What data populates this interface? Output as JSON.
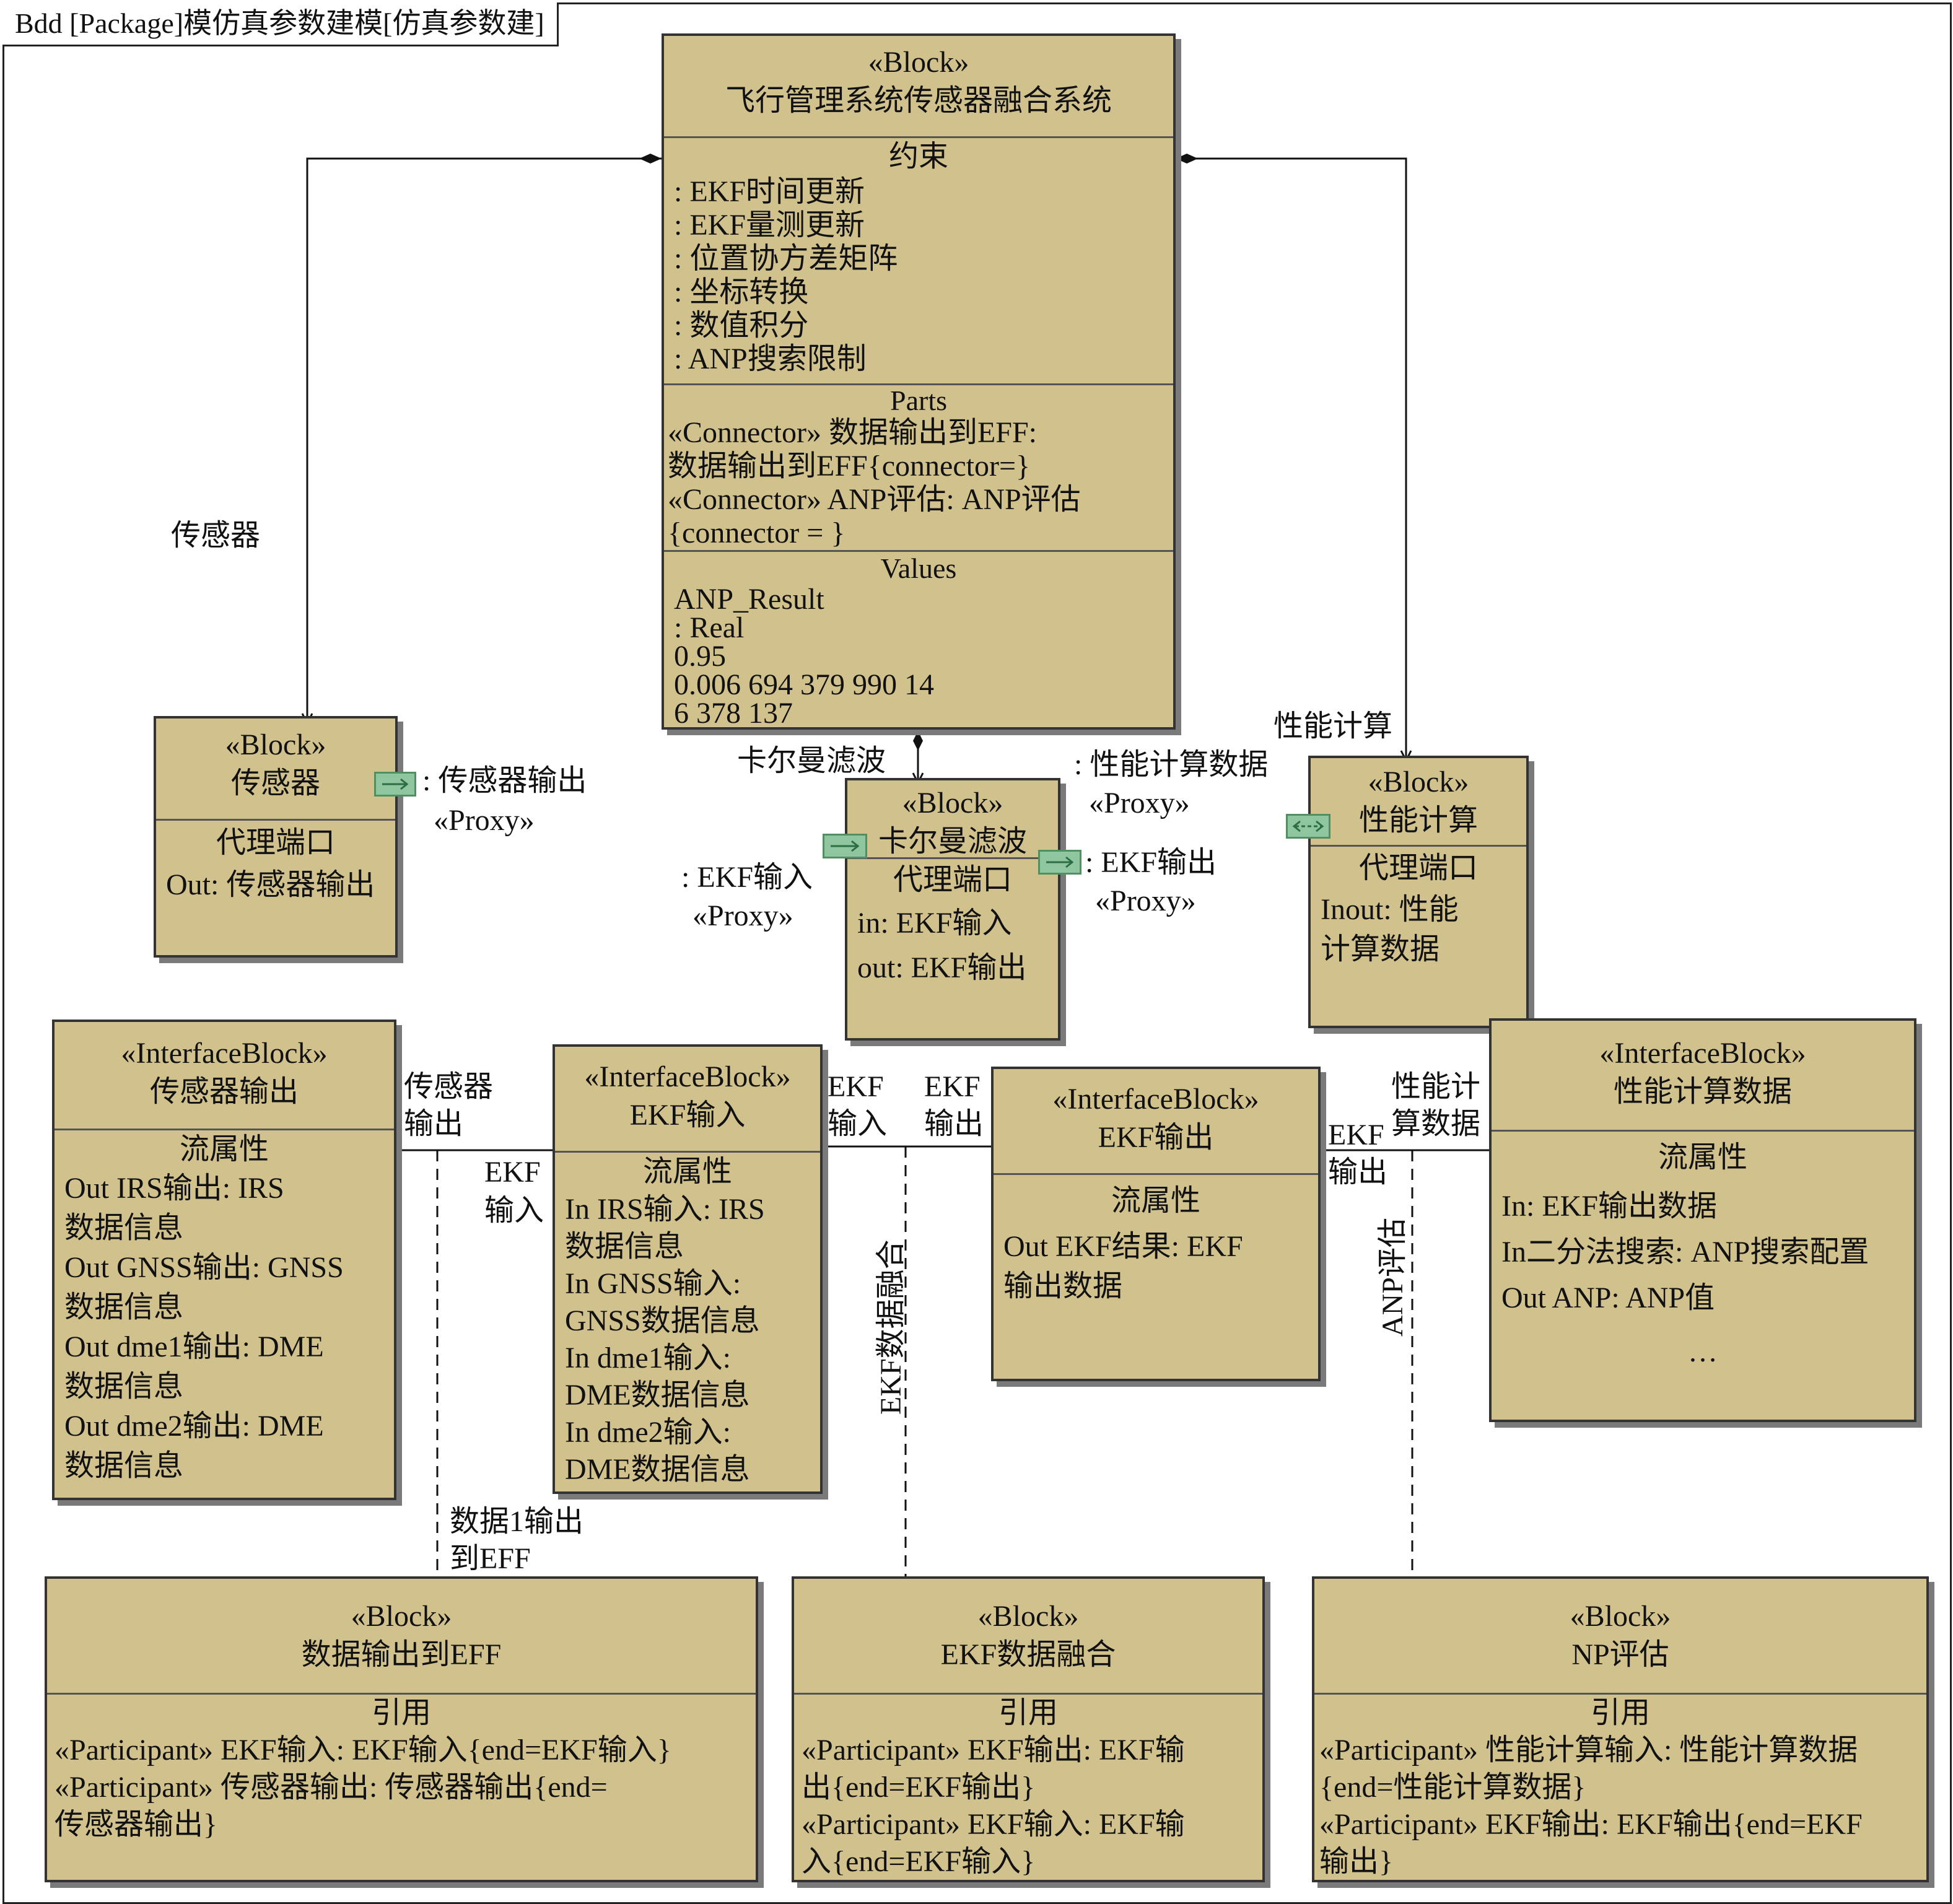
{
  "frame": {
    "title": "Bdd [Package]模仿真参数建模[仿真参数建]"
  },
  "colors": {
    "block_fill": "#d1c28d",
    "port_fill": "#8fc6a0",
    "line": "#111111"
  },
  "main_block": {
    "stereotype": "«Block»",
    "name": "飞行管理系统传感器融合系统",
    "constraints_title": "约束",
    "constraints": [
      ": EKF时间更新",
      ": EKF量测更新",
      ": 位置协方差矩阵",
      ": 坐标转换",
      ": 数值积分",
      ": ANP搜索限制"
    ],
    "parts_title": "Parts",
    "parts": [
      "«Connector» 数据输出到EFF:",
      "数据输出到EFF{connector=}",
      "«Connector» ANP评估: ANP评估",
      "{connector = }"
    ],
    "values_title": "Values",
    "values": [
      "ANP_Result",
      ": Real",
      "0.95",
      "0.006 694 379 990 14",
      "6 378 137"
    ]
  },
  "sensor_block": {
    "stereotype": "«Block»",
    "name": "传感器",
    "section_title": "代理端口",
    "rows": [
      "Out: 传感器输出"
    ],
    "port_label": ": 传感器输出",
    "port_stereo": "«Proxy»",
    "assoc_label": "传感器"
  },
  "kalman_block": {
    "stereotype": "«Block»",
    "name": "卡尔曼滤波",
    "section_title": "代理端口",
    "rows": [
      "in: EKF输入",
      "out: EKF输出"
    ],
    "in_port_label": ": EKF输入",
    "in_port_stereo": "«Proxy»",
    "out_port_label": ": EKF输出",
    "out_port_stereo": "«Proxy»",
    "assoc_label": "卡尔曼滤波"
  },
  "perf_block": {
    "stereotype": "«Block»",
    "name": "性能计算",
    "section_title": "代理端口",
    "rows": [
      "Inout: 性能",
      "计算数据"
    ],
    "port_label": ": 性能计算数据",
    "port_stereo": "«Proxy»",
    "assoc_label": "性能计算"
  },
  "if_sensor_out": {
    "stereotype": "«InterfaceBlock»",
    "name": "传感器输出",
    "section_title": "流属性",
    "rows": [
      "Out IRS输出: IRS",
      "数据信息",
      "Out GNSS输出: GNSS",
      "数据信息",
      "Out dme1输出: DME",
      "数据信息",
      "Out dme2输出: DME",
      "数据信息"
    ]
  },
  "if_ekf_in": {
    "stereotype": "«InterfaceBlock»",
    "name": "EKF输入",
    "section_title": "流属性",
    "rows": [
      "In IRS输入: IRS",
      "数据信息",
      "In GNSS输入:",
      "GNSS数据信息",
      "In dme1输入:",
      "DME数据信息",
      "In dme2输入:",
      "DME数据信息"
    ]
  },
  "if_ekf_out": {
    "stereotype": "«InterfaceBlock»",
    "name": "EKF输出",
    "section_title": "流属性",
    "rows": [
      "Out EKF结果: EKF",
      "输出数据"
    ]
  },
  "if_perf_data": {
    "stereotype": "«InterfaceBlock»",
    "name": "性能计算数据",
    "section_title": "流属性",
    "rows": [
      "In: EKF输出数据",
      "In二分法搜索: ANP搜索配置",
      "Out ANP: ANP值"
    ],
    "ellipsis": "…"
  },
  "assoc_block_eff": {
    "stereotype": "«Block»",
    "name": "数据输出到EFF",
    "section_title": "引用",
    "rows": [
      "«Participant» EKF输入: EKF输入{end=EKF输入}",
      "«Participant» 传感器输出: 传感器输出{end=",
      "传感器输出}"
    ]
  },
  "assoc_block_fusion": {
    "stereotype": "«Block»",
    "name": "EKF数据融合",
    "section_title": "引用",
    "rows": [
      "«Participant» EKF输出: EKF输",
      "出{end=EKF输出}",
      "«Participant» EKF输入: EKF输",
      "入{end=EKF输入}"
    ]
  },
  "assoc_block_np": {
    "stereotype": "«Block»",
    "name": "NP评估",
    "section_title": "引用",
    "rows": [
      "«Participant» 性能计算输入: 性能计算数据",
      "{end=性能计算数据}",
      "«Participant» EKF输出: EKF输出{end=EKF",
      "输出}"
    ]
  },
  "connector_labels": {
    "sensor_out_end_1": "传感器",
    "sensor_out_end_2": "输出",
    "ekf_in_end_1": "EKF",
    "ekf_in_end_2": "输入",
    "ekf_in_end_b1": "EKF",
    "ekf_in_end_b2": "输入",
    "ekf_out_end_1": "EKF",
    "ekf_out_end_2": "输出",
    "ekf_out_end_b1": "EKF",
    "ekf_out_end_b2": "输出",
    "perf_end_1": "性能计",
    "perf_end_2": "算数据",
    "assoc_eff_1": "数据1输出",
    "assoc_eff_2": "到EFF",
    "assoc_fusion": "EKF数据融合",
    "assoc_anp": "ANP评估"
  }
}
